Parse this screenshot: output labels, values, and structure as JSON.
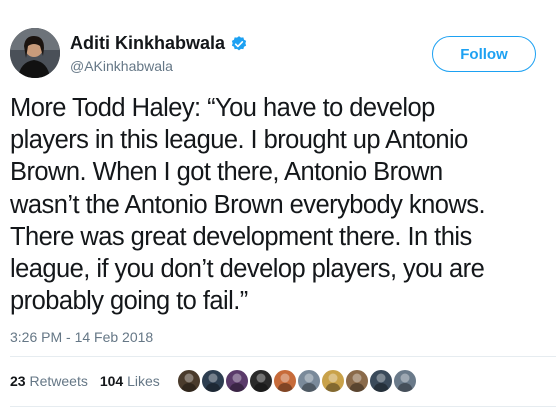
{
  "author": {
    "display_name": "Aditi Kinkhabwala",
    "handle": "@AKinkhabwala",
    "verified": true,
    "avatar_icon": "profile-photo"
  },
  "follow_button": {
    "label": "Follow"
  },
  "tweet": {
    "text_lines": [
      "More Todd Haley: “You have to develop",
      "players in this league. I brought up Antonio",
      "Brown. When I got there, Antonio Brown",
      "wasn’t the Antonio Brown everybody knows.",
      "There was great development there. In this",
      "league, if you don’t develop players, you are",
      "probably going to fail.”"
    ],
    "timestamp": "3:26 PM - 14 Feb 2018"
  },
  "stats": {
    "retweets_count": "23",
    "retweets_label": "Retweets",
    "likes_count": "104",
    "likes_label": "Likes"
  },
  "likers": [
    {
      "icon": "user-avatar",
      "color": "#4a3b2c"
    },
    {
      "icon": "user-avatar",
      "color": "#2d3e50"
    },
    {
      "icon": "user-avatar",
      "color": "#5a3a6a"
    },
    {
      "icon": "user-avatar",
      "color": "#2a2a2a"
    },
    {
      "icon": "user-avatar",
      "color": "#c76b3a"
    },
    {
      "icon": "user-avatar",
      "color": "#7a8a9a"
    },
    {
      "icon": "user-avatar",
      "color": "#c9a24a"
    },
    {
      "icon": "user-avatar",
      "color": "#8a6a4a"
    },
    {
      "icon": "user-avatar",
      "color": "#3a4a5a"
    },
    {
      "icon": "user-avatar",
      "color": "#6a7a8a"
    }
  ],
  "colors": {
    "accent": "#1da1f2",
    "text": "#14171a",
    "secondary": "#657786"
  }
}
